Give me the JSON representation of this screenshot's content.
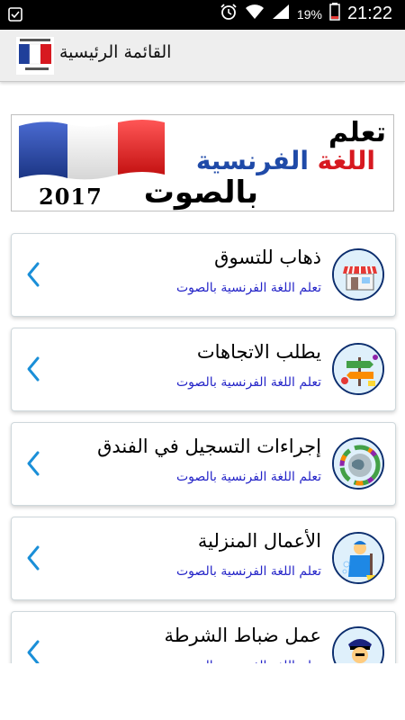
{
  "status_bar": {
    "battery_percent": "19%",
    "time": "21:22",
    "icons": [
      "notification-icon",
      "alarm-icon",
      "wifi-icon",
      "signal-icon",
      "battery-icon"
    ]
  },
  "action_bar": {
    "title": "القائمة الرئيسية",
    "app_icon": "french-flag-app-icon"
  },
  "banner": {
    "line1": "تعلم",
    "line2_red": "اللغة ",
    "line2_blue": "الفرنسية",
    "line3": "بالصوت",
    "year": "2017"
  },
  "items": [
    {
      "title": "ذهاب للتسوق",
      "subtitle": "تعلم اللغة الفرنسية بالصوت",
      "icon": "shop-icon"
    },
    {
      "title": "يطلب الاتجاهات",
      "subtitle": "تعلم اللغة الفرنسية بالصوت",
      "icon": "directions-icon"
    },
    {
      "title": "إجراءات التسجيل في الفندق",
      "subtitle": "تعلم اللغة الفرنسية بالصوت",
      "icon": "globe-icon"
    },
    {
      "title": "الأعمال المنزلية",
      "subtitle": "تعلم اللغة الفرنسية بالصوت",
      "icon": "housework-icon"
    },
    {
      "title": "عمل ضباط الشرطة",
      "subtitle": "تعلم اللغة الفرنسية بالصوت",
      "icon": "police-officer-icon"
    }
  ],
  "colors": {
    "subtitle": "#2525c8",
    "chevron": "#1a8fd8",
    "action_bar": "#eeeeee",
    "thumb_border": "#0c2e6e"
  }
}
